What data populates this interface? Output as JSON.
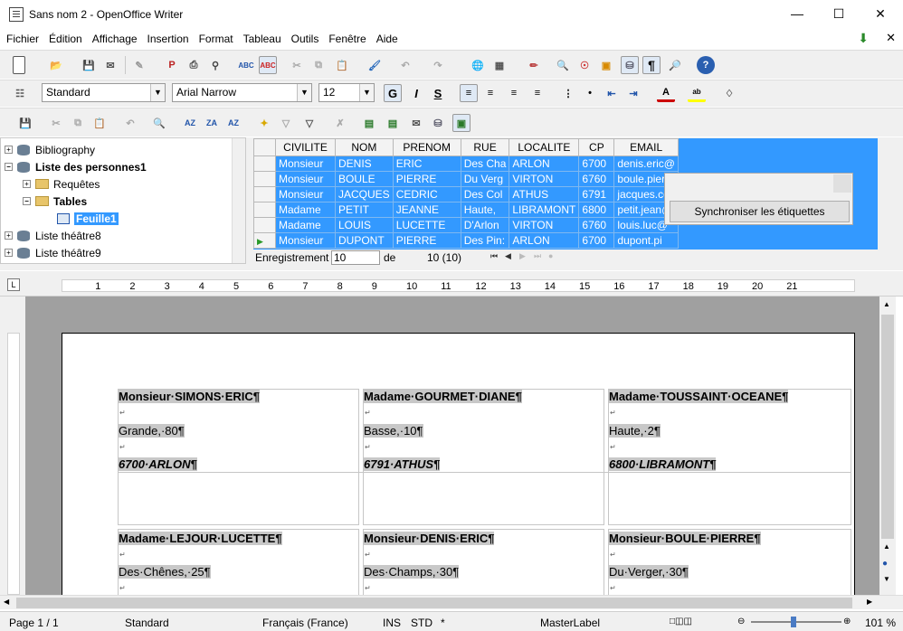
{
  "window": {
    "title": "Sans nom 2 - OpenOffice Writer"
  },
  "menu": [
    "Fichier",
    "Édition",
    "Affichage",
    "Insertion",
    "Format",
    "Tableau",
    "Outils",
    "Fenêtre",
    "Aide"
  ],
  "format_bar": {
    "style": "Standard",
    "font": "Arial Narrow",
    "size": "12"
  },
  "tree": {
    "items": [
      {
        "label": "Bibliography",
        "sign": "+"
      },
      {
        "label": "Liste des personnes1",
        "sign": "−"
      },
      {
        "label": "Requêtes",
        "sign": "+"
      },
      {
        "label": "Tables",
        "sign": "−"
      },
      {
        "label": "Feuille1",
        "sign": ""
      },
      {
        "label": "Liste théâtre8",
        "sign": "+"
      },
      {
        "label": "Liste théâtre9",
        "sign": "+"
      }
    ]
  },
  "grid": {
    "columns": [
      "CIVILITE",
      "NOM",
      "PRENOM",
      "RUE",
      "LOCALITE",
      "CP",
      "EMAIL"
    ],
    "rows": [
      [
        "Monsieur",
        "DENIS",
        "ERIC",
        "Des Cha",
        "ARLON",
        "6700",
        "denis.eric@"
      ],
      [
        "Monsieur",
        "BOULE",
        "PIERRE",
        "Du Verg",
        "VIRTON",
        "6760",
        "boule.pier"
      ],
      [
        "Monsieur",
        "JACQUES",
        "CEDRIC",
        "Des Col",
        "ATHUS",
        "6791",
        "jacques.ce"
      ],
      [
        "Madame",
        "PETIT",
        "JEANNE",
        "Haute, ",
        "LIBRAMONT",
        "6800",
        "petit.jean@"
      ],
      [
        "Madame",
        "LOUIS",
        "LUCETTE",
        "D'Arlon",
        "VIRTON",
        "6760",
        "louis.luc@"
      ],
      [
        "Monsieur",
        "DUPONT",
        "PIERRE",
        "Des Pin:",
        "ARLON",
        "6700",
        "dupont.pi"
      ]
    ]
  },
  "popup": {
    "button": "Synchroniser les étiquettes"
  },
  "navbar": {
    "label": "Enregistrement",
    "value": "10",
    "of": "de",
    "total": "10 (10)"
  },
  "labels": [
    {
      "name": "Monsieur·SIMONS·ERIC¶",
      "street": "Grande,·80¶",
      "city": "6700·ARLON¶"
    },
    {
      "name": "Madame·GOURMET·DIANE¶",
      "street": "Basse,·10¶",
      "city": "6791·ATHUS¶"
    },
    {
      "name": "Madame·TOUSSAINT·OCEANE¶",
      "street": "Haute,·2¶",
      "city": "6800·LIBRAMONT¶"
    },
    {
      "name": "Madame·LEJOUR·LUCETTE¶",
      "street": "Des·Chênes,·25¶",
      "city": ""
    },
    {
      "name": "Monsieur·DENIS·ERIC¶",
      "street": "Des·Champs,·30¶",
      "city": ""
    },
    {
      "name": "Monsieur·BOULE·PIERRE¶",
      "street": "Du·Verger,·30¶",
      "city": ""
    }
  ],
  "status": {
    "page": "Page 1 / 1",
    "style": "Standard",
    "lang": "Français (France)",
    "ins": "INS",
    "std": "STD",
    "star": "*",
    "master": "MasterLabel",
    "zoom": "101 %"
  }
}
